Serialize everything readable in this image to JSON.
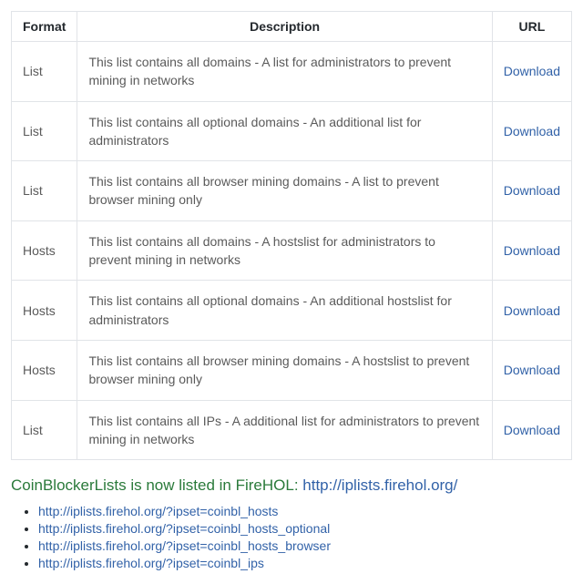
{
  "table": {
    "headers": {
      "format": "Format",
      "description": "Description",
      "url": "URL"
    },
    "rows": [
      {
        "format": "List",
        "description": "This list contains all domains - A list for administrators to prevent mining in networks",
        "link": "Download"
      },
      {
        "format": "List",
        "description": "This list contains all optional domains - An additional list for administrators",
        "link": "Download"
      },
      {
        "format": "List",
        "description": "This list contains all browser mining domains - A list to prevent browser mining only",
        "link": "Download"
      },
      {
        "format": "Hosts",
        "description": "This list contains all domains - A hostslist for administrators to prevent mining in networks",
        "link": "Download"
      },
      {
        "format": "Hosts",
        "description": "This list contains all optional domains - An additional hostslist for administrators",
        "link": "Download"
      },
      {
        "format": "Hosts",
        "description": "This list contains all browser mining domains - A hostslist to prevent browser mining only",
        "link": "Download"
      },
      {
        "format": "List",
        "description": "This list contains all IPs - A additional list for administrators to prevent mining in networks",
        "link": "Download"
      }
    ]
  },
  "heading": {
    "prefix": "CoinBlockerLists is now listed in FireHOL: ",
    "link": "http://iplists.firehol.org/"
  },
  "links": [
    "http://iplists.firehol.org/?ipset=coinbl_hosts",
    "http://iplists.firehol.org/?ipset=coinbl_hosts_optional",
    "http://iplists.firehol.org/?ipset=coinbl_hosts_browser",
    "http://iplists.firehol.org/?ipset=coinbl_ips"
  ]
}
